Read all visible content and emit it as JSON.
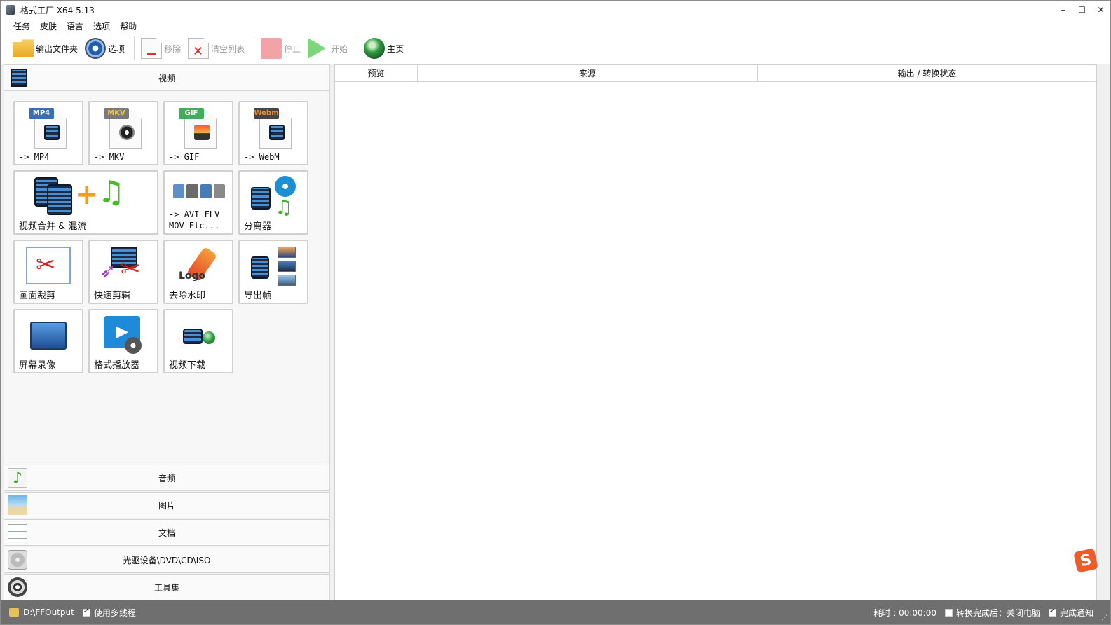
{
  "window": {
    "title": "格式工厂 X64 5.13"
  },
  "menu": [
    "任务",
    "皮肤",
    "语言",
    "选项",
    "帮助"
  ],
  "toolbar": {
    "output_folder": "输出文件夹",
    "options": "选项",
    "remove": "移除",
    "clear_list": "清空列表",
    "stop": "停止",
    "start": "开始",
    "home": "主页"
  },
  "categories": {
    "video": "视频",
    "audio": "音频",
    "image": "图片",
    "document": "文档",
    "optical": "光驱设备\\DVD\\CD\\ISO",
    "tools": "工具集"
  },
  "video_tiles": {
    "mp4": {
      "badge": "MP4",
      "label": "-> MP4"
    },
    "mkv": {
      "badge": "MKV",
      "label": "-> MKV"
    },
    "gif": {
      "badge": "GIF",
      "label": "-> GIF"
    },
    "webm": {
      "badge": "Webm",
      "label": "-> WebM"
    },
    "merge": {
      "label": "视频合并 & 混流"
    },
    "avi": {
      "label": "-> AVI FLV\nMOV Etc..."
    },
    "splitter": {
      "label": "分离器"
    },
    "crop": {
      "label": "画面裁剪"
    },
    "quick_edit": {
      "label": "快速剪辑"
    },
    "watermark": {
      "label": "去除水印",
      "logo_text": "Logo"
    },
    "export_frames": {
      "label": "导出帧"
    },
    "screen_record": {
      "label": "屏幕录像"
    },
    "player": {
      "label": "格式播放器"
    },
    "download": {
      "label": "视频下载"
    }
  },
  "table": {
    "columns": [
      "预览",
      "来源",
      "输出 / 转换状态"
    ]
  },
  "status": {
    "output_path": "D:\\FFOutput",
    "multithread_label": "使用多线程",
    "multithread": true,
    "elapsed": "耗时 : 00:00:00",
    "shutdown_label": "转换完成后：关闭电脑",
    "shutdown": false,
    "notify_label": "完成通知",
    "notify": true
  },
  "colors": {
    "accent_blue": "#1d5fb4",
    "mp4": "#3a6fb5",
    "mkv": "#7a7a7a",
    "gif": "#3fae5a",
    "webm": "#e8862b",
    "status_bar": "#6f6f6f"
  }
}
